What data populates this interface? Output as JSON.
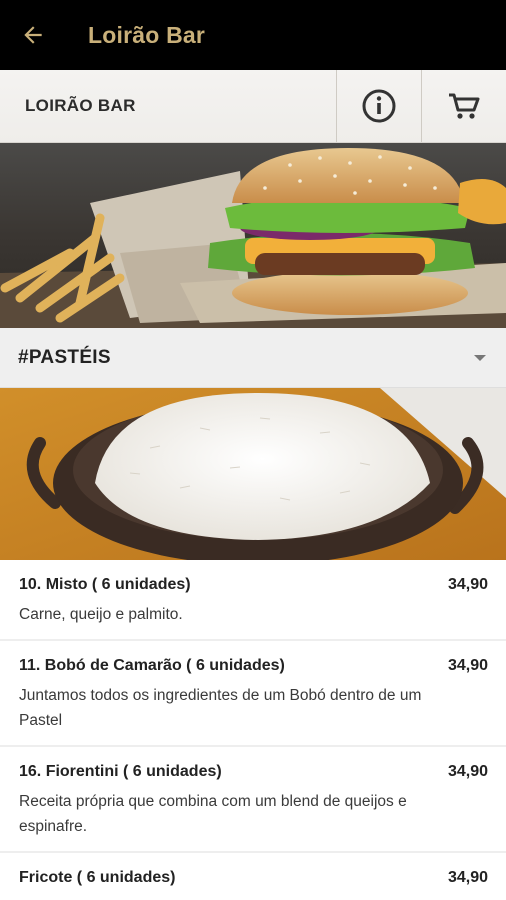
{
  "app": {
    "title": "Loirão Bar"
  },
  "store": {
    "name": "LOIRÃO BAR"
  },
  "category": {
    "label": "#PASTÉIS"
  },
  "colors": {
    "appbar_bg": "#000000",
    "title_accent": "#c9b07a"
  },
  "icons": {
    "back": "arrow-left-icon",
    "info": "info-icon",
    "cart": "cart-icon",
    "dropdown": "chevron-down-icon"
  },
  "items": [
    {
      "name": "10. Misto ( 6 unidades)",
      "price": "34,90",
      "description": "Carne, queijo e palmito."
    },
    {
      "name": "11. Bobó de Camarão ( 6 unidades)",
      "price": "34,90",
      "description": "Juntamos todos os ingredientes de um Bobó dentro de um Pastel"
    },
    {
      "name": "16. Fiorentini ( 6 unidades)",
      "price": "34,90",
      "description": "Receita própria que combina com um blend de queijos e espinafre."
    },
    {
      "name": "Fricote ( 6 unidades)",
      "price": "34,90",
      "description": ""
    }
  ]
}
